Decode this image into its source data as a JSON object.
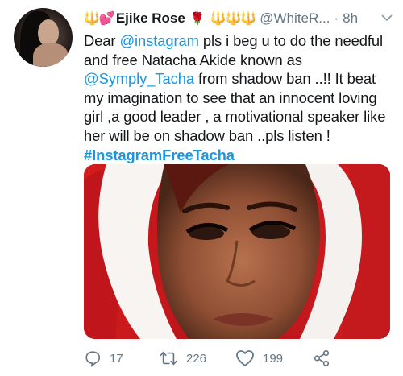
{
  "tweet": {
    "author": {
      "name_prefix": "🔱💕",
      "name": "Ejike Rose",
      "name_suffix_rose": "🌹",
      "name_suffix_crowns": "🔱🔱🔱",
      "handle": "@WhiteR...",
      "separator": "·",
      "time": "8h"
    },
    "body": {
      "t1": "Dear ",
      "mention1": "@instagram",
      "t2": " pls i beg u to do the needful and free Natacha Akide known as ",
      "mention2": "@Symply_Tacha",
      "t3": "  from shadow ban ..!! It beat my imagination to see that an innocent loving girl ,a good leader , a motivational speaker like her will be on shadow ban ..pls listen !",
      "hashtag": "#InstagramFreeTacha"
    },
    "actions": {
      "replies": "17",
      "retweets": "226",
      "likes": "199"
    }
  }
}
